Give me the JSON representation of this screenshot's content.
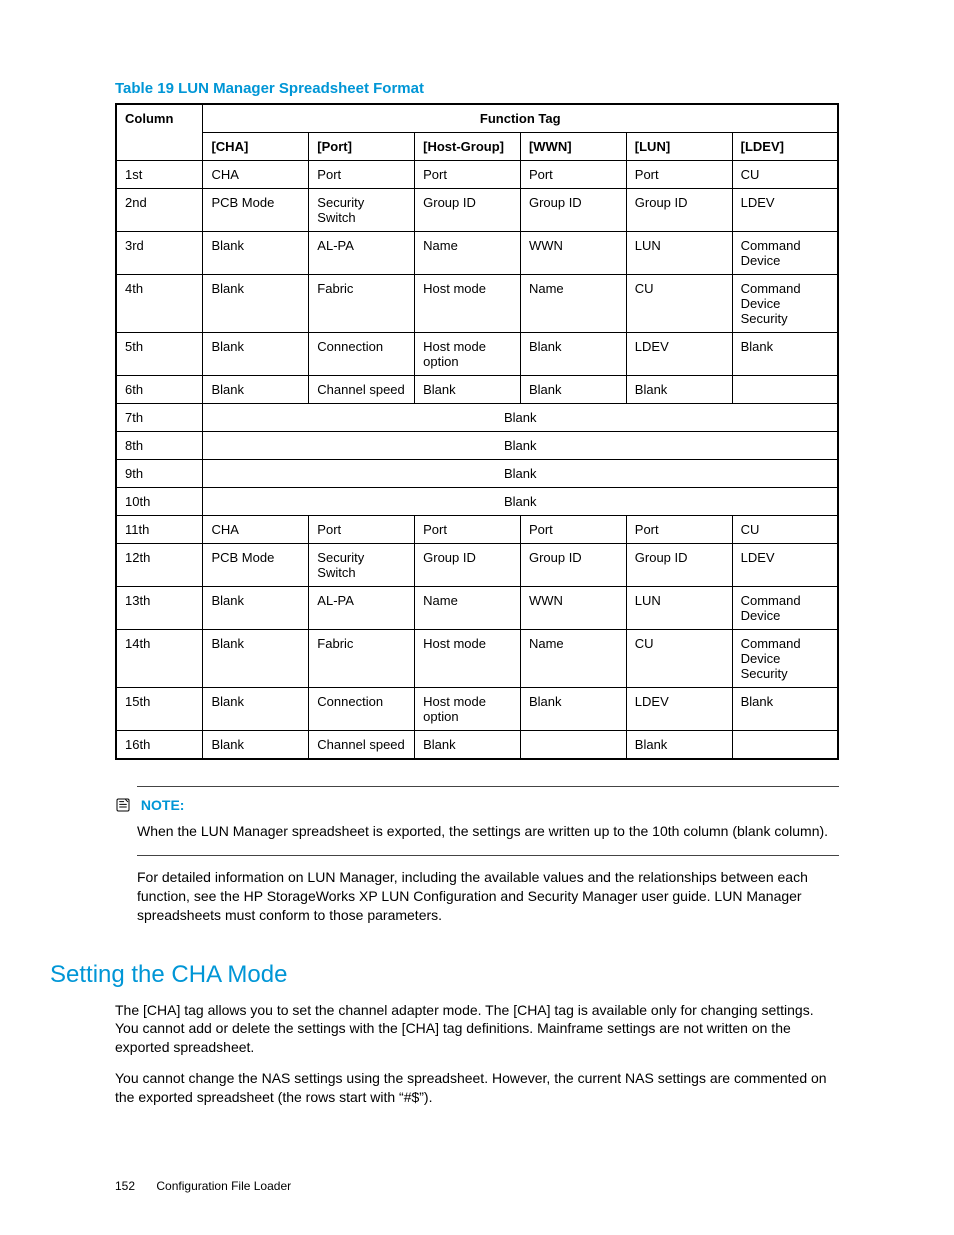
{
  "table_title": "Table 19 LUN Manager Spreadsheet Format",
  "headers": {
    "column": "Column",
    "function_tag": "Function Tag",
    "sub": [
      "[CHA]",
      "[Port]",
      "[Host-Group]",
      "[WWN]",
      "[LUN]",
      "[LDEV]"
    ]
  },
  "rows": [
    {
      "col": "1st",
      "cells": [
        "CHA",
        "Port",
        "Port",
        "Port",
        "Port",
        "CU"
      ]
    },
    {
      "col": "2nd",
      "cells": [
        "PCB Mode",
        "Security Switch",
        "Group ID",
        "Group ID",
        "Group ID",
        "LDEV"
      ]
    },
    {
      "col": "3rd",
      "cells": [
        "Blank",
        "AL-PA",
        "Name",
        "WWN",
        "LUN",
        "Command Device"
      ]
    },
    {
      "col": "4th",
      "cells": [
        "Blank",
        "Fabric",
        "Host mode",
        "Name",
        "CU",
        "Command Device Security"
      ]
    },
    {
      "col": "5th",
      "cells": [
        "Blank",
        "Connection",
        "Host mode option",
        "Blank",
        "LDEV",
        "Blank"
      ]
    },
    {
      "col": "6th",
      "cells": [
        "Blank",
        "Channel speed",
        "Blank",
        "Blank",
        "Blank",
        ""
      ]
    },
    {
      "col": "7th",
      "span": "Blank"
    },
    {
      "col": "8th",
      "span": "Blank"
    },
    {
      "col": "9th",
      "span": "Blank"
    },
    {
      "col": "10th",
      "span": "Blank"
    },
    {
      "col": "11th",
      "cells": [
        "CHA",
        "Port",
        "Port",
        "Port",
        "Port",
        "CU"
      ]
    },
    {
      "col": "12th",
      "cells": [
        "PCB Mode",
        "Security Switch",
        "Group ID",
        "Group ID",
        "Group ID",
        "LDEV"
      ]
    },
    {
      "col": "13th",
      "cells": [
        "Blank",
        "AL-PA",
        "Name",
        "WWN",
        "LUN",
        "Command Device"
      ]
    },
    {
      "col": "14th",
      "cells": [
        "Blank",
        "Fabric",
        "Host mode",
        "Name",
        "CU",
        "Command Device Security"
      ]
    },
    {
      "col": "15th",
      "cells": [
        "Blank",
        "Connection",
        "Host mode option",
        "Blank",
        "LDEV",
        "Blank"
      ]
    },
    {
      "col": "16th",
      "cells": [
        "Blank",
        "Channel speed",
        "Blank",
        "",
        "Blank",
        ""
      ]
    }
  ],
  "note_label": "NOTE:",
  "note_text": "When the LUN Manager spreadsheet is exported, the settings are written up to the 10th column (blank column).",
  "para_after_note": "For detailed information on LUN Manager, including the available values and the relationships between each function, see the HP StorageWorks XP LUN Configuration and Security Manager user guide. LUN Manager spreadsheets must conform to those parameters.",
  "section_heading": "Setting the CHA Mode",
  "section_p1": "The [CHA] tag allows you to set the channel adapter mode. The [CHA] tag is available only for changing settings. You cannot add or delete the settings with the [CHA] tag definitions. Mainframe settings are not written on the exported spreadsheet.",
  "section_p2": "You cannot change the NAS settings using the spreadsheet. However, the current NAS settings are commented on the exported spreadsheet (the rows start with “#$”).",
  "footer_page": "152",
  "footer_title": "Configuration File Loader"
}
